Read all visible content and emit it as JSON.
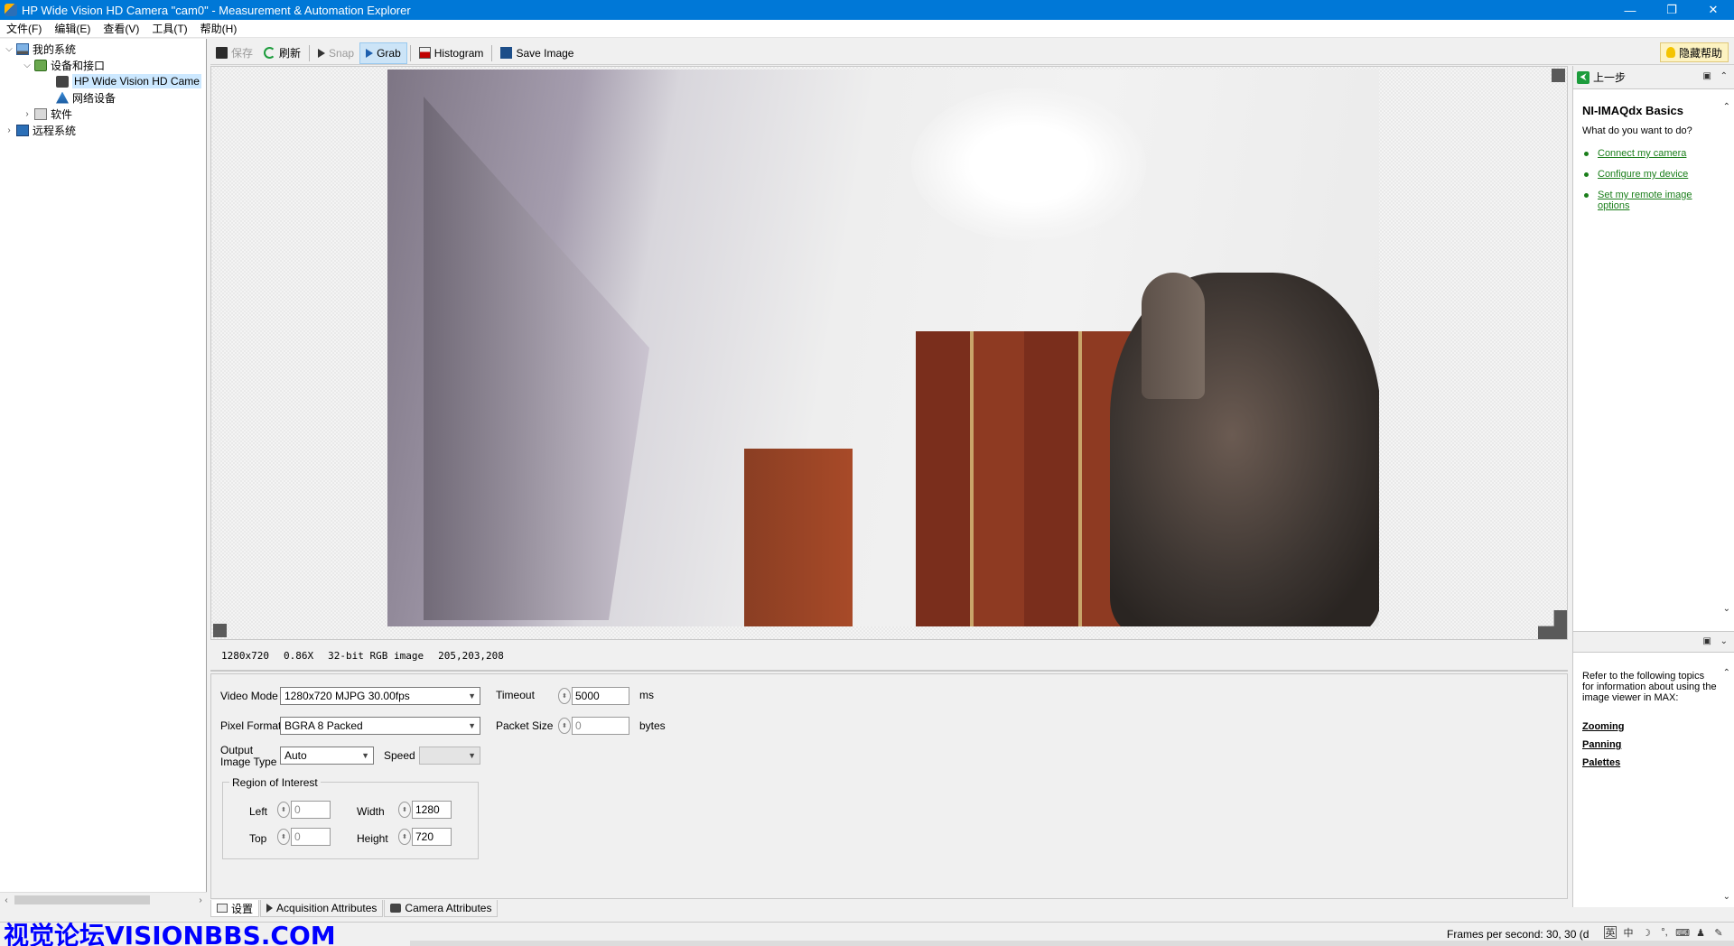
{
  "window": {
    "title": "HP Wide Vision HD Camera  \"cam0\" - Measurement & Automation Explorer",
    "minimize": "—",
    "maximize": "❐",
    "close": "✕"
  },
  "menu": [
    "文件(F)",
    "编辑(E)",
    "查看(V)",
    "工具(T)",
    "帮助(H)"
  ],
  "tree": {
    "items": [
      {
        "label": "我的系统",
        "expander": "⌵"
      },
      {
        "label": "设备和接口",
        "expander": "⌵"
      },
      {
        "label": "HP Wide Vision HD Came",
        "expander": ""
      },
      {
        "label": "网络设备",
        "expander": ""
      },
      {
        "label": "软件",
        "expander": "›"
      },
      {
        "label": "远程系统",
        "expander": "›"
      }
    ]
  },
  "toolbar": {
    "save": "保存",
    "refresh": "刷新",
    "snap": "Snap",
    "grab": "Grab",
    "histogram": "Histogram",
    "save_image": "Save Image",
    "hide_help": "隐藏帮助"
  },
  "image_info": {
    "resolution": "1280x720",
    "zoom": "0.86X",
    "type": "32-bit RGB image",
    "pixel": "205,203,208"
  },
  "settings": {
    "video_mode_label": "Video Mode",
    "video_mode_value": "1280x720 MJPG 30.00fps",
    "pixel_format_label": "Pixel Format",
    "pixel_format_value": "BGRA 8 Packed",
    "output_type_label_1": "Output",
    "output_type_label_2": "Image Type",
    "output_type_value": "Auto",
    "speed_label": "Speed",
    "speed_value": "",
    "timeout_label": "Timeout",
    "timeout_value": "5000",
    "timeout_unit": "ms",
    "packet_size_label": "Packet Size",
    "packet_size_value": "0",
    "packet_size_unit": "bytes",
    "roi_label": "Region of Interest",
    "left_label": "Left",
    "left_value": "0",
    "top_label": "Top",
    "top_value": "0",
    "width_label": "Width",
    "width_value": "1280",
    "height_label": "Height",
    "height_value": "720"
  },
  "tabs": [
    "设置",
    "Acquisition Attributes",
    "Camera Attributes"
  ],
  "help": {
    "back": "上一步",
    "heading": "NI-IMAQdx Basics",
    "question": "What do you want to do?",
    "links": [
      "Connect my camera",
      "Configure my device",
      "Set my remote image options"
    ],
    "reference": "Refer to the following topics for information about using the image viewer in MAX:",
    "topics": [
      "Zooming",
      "Panning",
      "Palettes"
    ]
  },
  "statusbar": {
    "watermark": "视觉论坛VISIONBBS.COM",
    "fps": "Frames per second: 30, 30 (d",
    "tray": [
      "英",
      "中",
      "☽",
      "°,",
      "⌨",
      "♟",
      "✎"
    ]
  }
}
